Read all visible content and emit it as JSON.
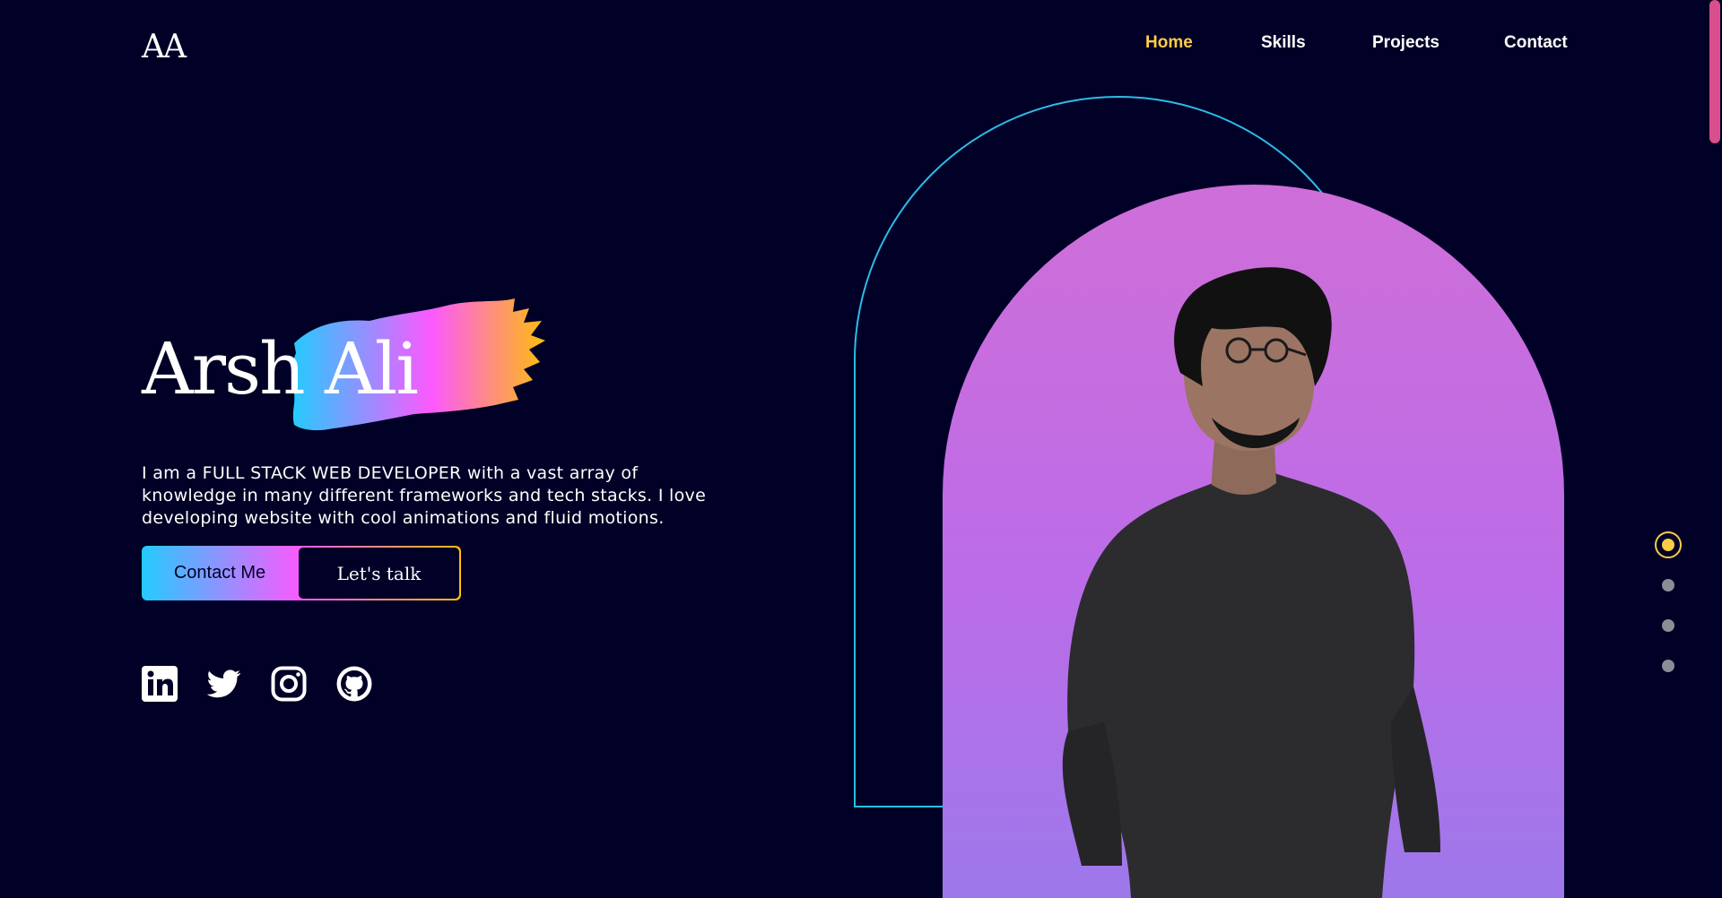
{
  "header": {
    "logo": "AA",
    "nav": [
      {
        "label": "Home",
        "active": true
      },
      {
        "label": "Skills",
        "active": false
      },
      {
        "label": "Projects",
        "active": false
      },
      {
        "label": "Contact",
        "active": false
      }
    ]
  },
  "hero": {
    "first_name": "Arsh",
    "last_name": "Ali",
    "intro": "I am a FULL STACK WEB DEVELOPER with a vast array of knowledge in many different frameworks and tech stacks. I love developing website with cool animations and fluid motions.",
    "contact_button": "Contact Me",
    "talk_button": "Let's talk",
    "social_icons": [
      "linkedin-icon",
      "twitter-icon",
      "instagram-icon",
      "github-icon"
    ]
  },
  "section_dots": {
    "count": 4,
    "active_index": 0
  },
  "colors": {
    "background": "#010026",
    "accent_yellow": "#fdcc49",
    "gradient": [
      "#24cbff",
      "#fc59ff",
      "#ffbd0c"
    ],
    "arch_outline": "#2cbce9",
    "arch_fill": "#c56ee0"
  }
}
